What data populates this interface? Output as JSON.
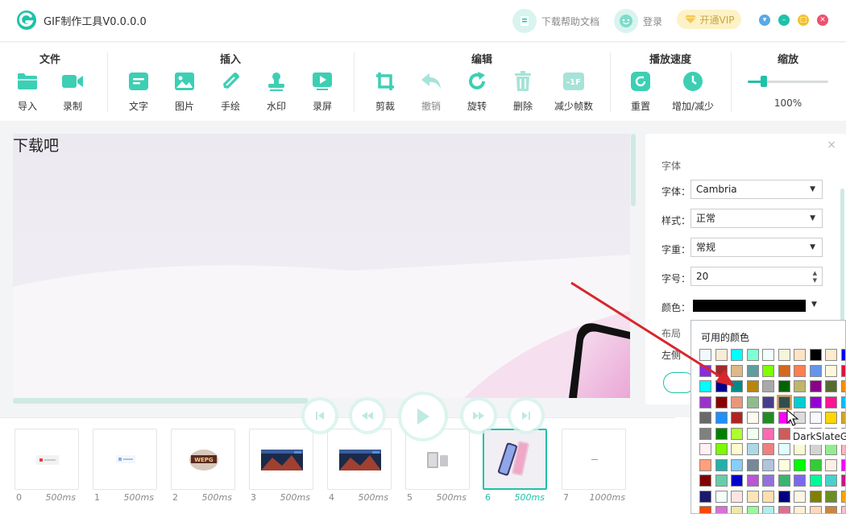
{
  "app": {
    "title": "GIF制作工具V0.0.0.0"
  },
  "titlebar": {
    "help": "下载帮助文档",
    "login": "登录",
    "vip": "开通VIP"
  },
  "toolbar": {
    "groups": {
      "file": "文件",
      "insert": "插入",
      "edit": "编辑",
      "speed": "播放速度",
      "zoom": "缩放"
    },
    "tools": {
      "import": "导入",
      "record": "录制",
      "text": "文字",
      "image": "图片",
      "draw": "手绘",
      "watermark": "水印",
      "screen_record": "录屏",
      "crop": "剪裁",
      "undo": "撤销",
      "rotate": "旋转",
      "delete": "删除",
      "reduce_frames": "减少帧数",
      "reset": "重置",
      "adjust": "增加/减少"
    },
    "zoom_value": "100%",
    "zoom_fraction": 0.2
  },
  "canvas": {
    "overlay_text": "下载吧"
  },
  "panel": {
    "section_font": "字体",
    "font_label": "字体：",
    "font_value": "Cambria",
    "style_label": "样式：",
    "style_value": "正常",
    "weight_label": "字重：",
    "weight_value": "常规",
    "size_label": "字号：",
    "size_value": "20",
    "color_label": "颜色：",
    "section_layout": "布局",
    "left_label": "左侧"
  },
  "color_popup": {
    "title": "可用的颜色",
    "tooltip": "DarkSlateGray",
    "rows": [
      [
        "#f0f8ff",
        "#faebd7",
        "#00ffff",
        "#7fffd4",
        "#f0ffff",
        "#f5f5dc",
        "#ffe4c4",
        "#000000",
        "#ffebcd",
        "#0000ff"
      ],
      [
        "#8a2be2",
        "#a52a2a",
        "#deb887",
        "#5f9ea0",
        "#7fff00",
        "#d2691e",
        "#ff7f50",
        "#6495ed",
        "#fff8dc",
        "#dc143c"
      ],
      [
        "#00ffff",
        "#00008b",
        "#008b8b",
        "#b8860b",
        "#a9a9a9",
        "#006400",
        "#bdb76b",
        "#8b008b",
        "#556b2f",
        "#ff8c00"
      ],
      [
        "#9932cc",
        "#8b0000",
        "#e9967a",
        "#8fbc8f",
        "#483d8b",
        "#2f4f4f",
        "#00ced1",
        "#9400d3",
        "#ff1493",
        "#00bfff"
      ],
      [
        "#696969",
        "#1e90ff",
        "#b22222",
        "#fffaf0",
        "#228b22",
        "#ff00ff",
        "#dcdcdc",
        "#f8f8ff",
        "#ffd700",
        "#daa520"
      ],
      [
        "#808080",
        "#008000",
        "#adff2f",
        "#f0fff0",
        "#ff69b4",
        "#cd5c5c",
        "#4b0082",
        "#fffff0",
        "#f0e68c",
        "#e6e6fa"
      ],
      [
        "#fff0f5",
        "#7cfc00",
        "#fffacd",
        "#add8e6",
        "#f08080",
        "#e0ffff",
        "#fafad2",
        "#d3d3d3",
        "#90ee90",
        "#ffb6c1"
      ],
      [
        "#ffa07a",
        "#20b2aa",
        "#87cefa",
        "#778899",
        "#b0c4de",
        "#ffffe0",
        "#00ff00",
        "#32cd32",
        "#faf0e6",
        "#ff00ff"
      ],
      [
        "#800000",
        "#66cdaa",
        "#0000cd",
        "#ba55d3",
        "#9370db",
        "#3cb371",
        "#7b68ee",
        "#00fa9a",
        "#48d1cc",
        "#c71585"
      ],
      [
        "#191970",
        "#f5fffa",
        "#ffe4e1",
        "#ffe4b5",
        "#ffdead",
        "#000080",
        "#fdf5e6",
        "#808000",
        "#6b8e23",
        "#ffa500"
      ],
      [
        "#ff4500",
        "#da70d6",
        "#eee8aa",
        "#98fb98",
        "#afeeee",
        "#db7093",
        "#ffefd5",
        "#ffdab9",
        "#cd853f",
        "#ffc0cb"
      ]
    ],
    "highlight": {
      "row": 3,
      "col": 5
    }
  },
  "frames": [
    {
      "index": "0",
      "duration": "500ms"
    },
    {
      "index": "1",
      "duration": "500ms"
    },
    {
      "index": "2",
      "duration": "500ms"
    },
    {
      "index": "3",
      "duration": "500ms"
    },
    {
      "index": "4",
      "duration": "500ms"
    },
    {
      "index": "5",
      "duration": "500ms"
    },
    {
      "index": "6",
      "duration": "500ms"
    },
    {
      "index": "7",
      "duration": "1000ms"
    }
  ],
  "selected_frame": 6,
  "colors": {
    "accent": "#1ec2a8",
    "arrow": "#d8262c"
  }
}
